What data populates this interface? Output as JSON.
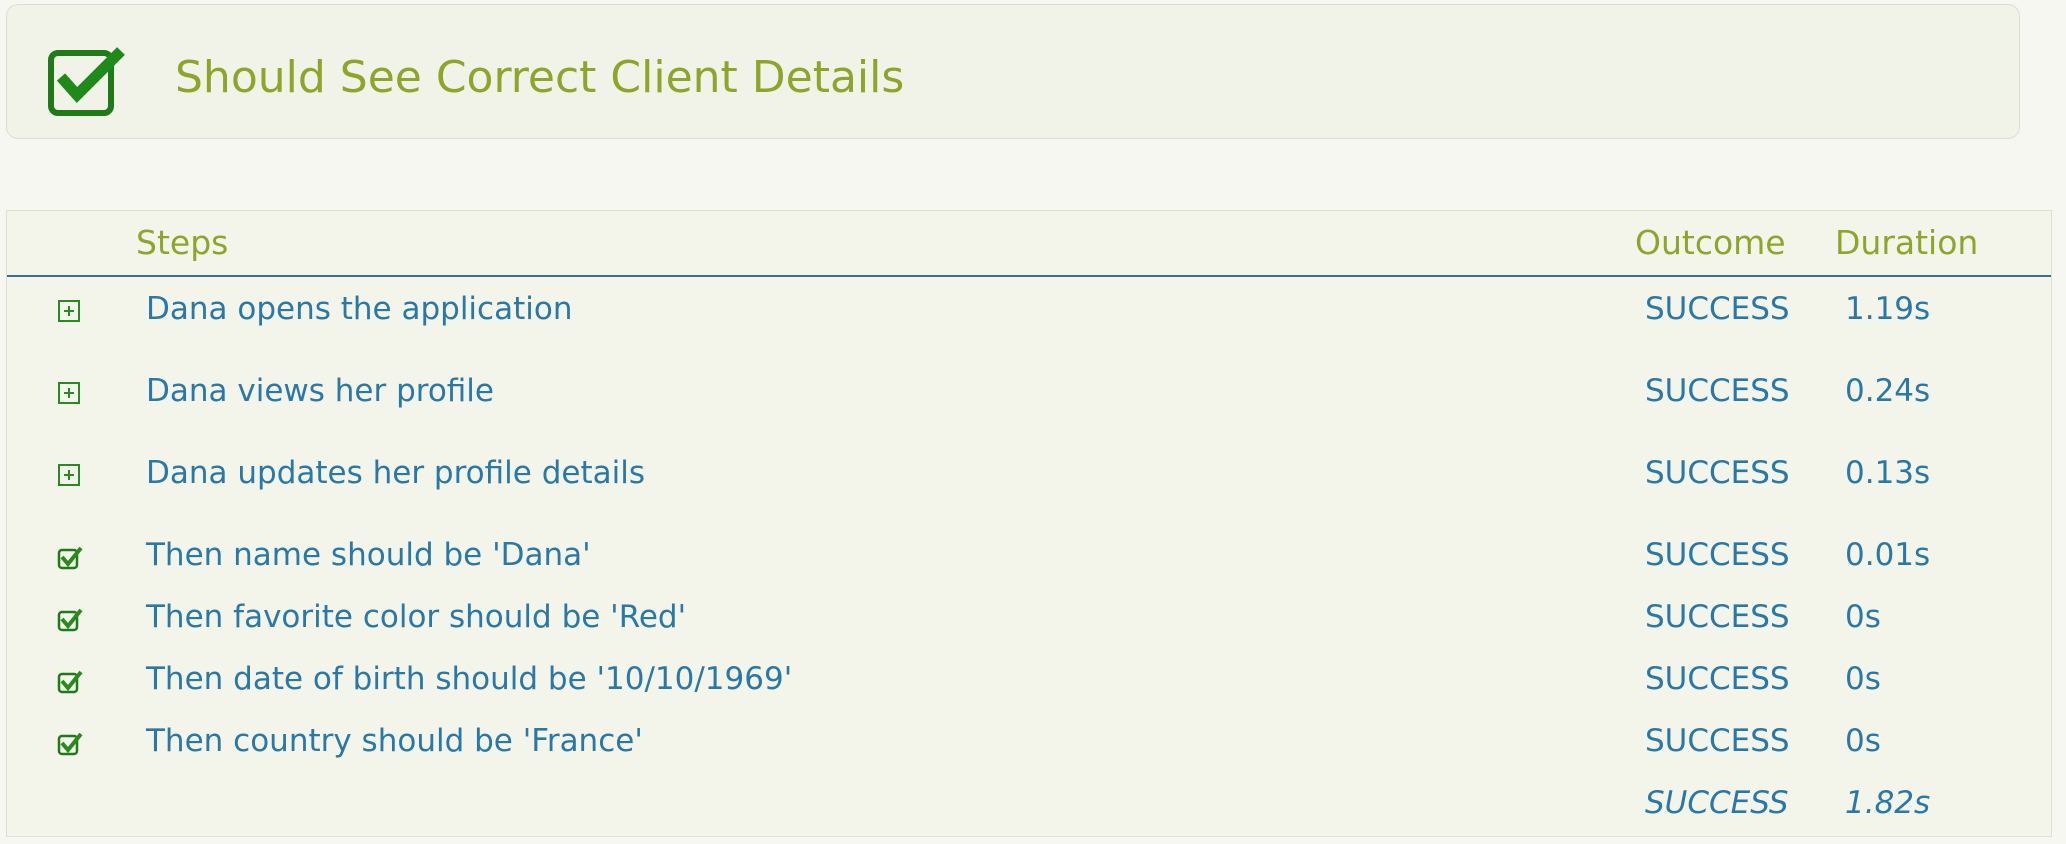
{
  "scenario": {
    "title": "Should See Correct Client Details",
    "status_icon": "checkbox-checked-icon",
    "status_color": "#2a8a1f"
  },
  "table": {
    "headers": {
      "steps": "Steps",
      "outcome": "Outcome",
      "duration": "Duration"
    },
    "rows": [
      {
        "icon": "expand-plus-icon",
        "step": "Dana opens the application",
        "outcome": "SUCCESS",
        "duration": "1.19s"
      },
      {
        "icon": "expand-plus-icon",
        "step": "Dana views her profile",
        "outcome": "SUCCESS",
        "duration": "0.24s"
      },
      {
        "icon": "expand-plus-icon",
        "step": "Dana updates her profile details",
        "outcome": "SUCCESS",
        "duration": "0.13s"
      },
      {
        "icon": "check-icon",
        "step": "Then name should be 'Dana'",
        "outcome": "SUCCESS",
        "duration": "0.01s"
      },
      {
        "icon": "check-icon",
        "step": "Then favorite color should be 'Red'",
        "outcome": "SUCCESS",
        "duration": "0s"
      },
      {
        "icon": "check-icon",
        "step": "Then date of birth should be '10/10/1969'",
        "outcome": "SUCCESS",
        "duration": "0s"
      },
      {
        "icon": "check-icon",
        "step": "Then country should be 'France'",
        "outcome": "SUCCESS",
        "duration": "0s"
      }
    ],
    "total": {
      "outcome": "SUCCESS",
      "duration": "1.82s"
    }
  },
  "colors": {
    "title": "#8da52a",
    "link": "#2a78a6",
    "header_rule": "#3b6f8f",
    "success_green": "#2a8a1f"
  }
}
